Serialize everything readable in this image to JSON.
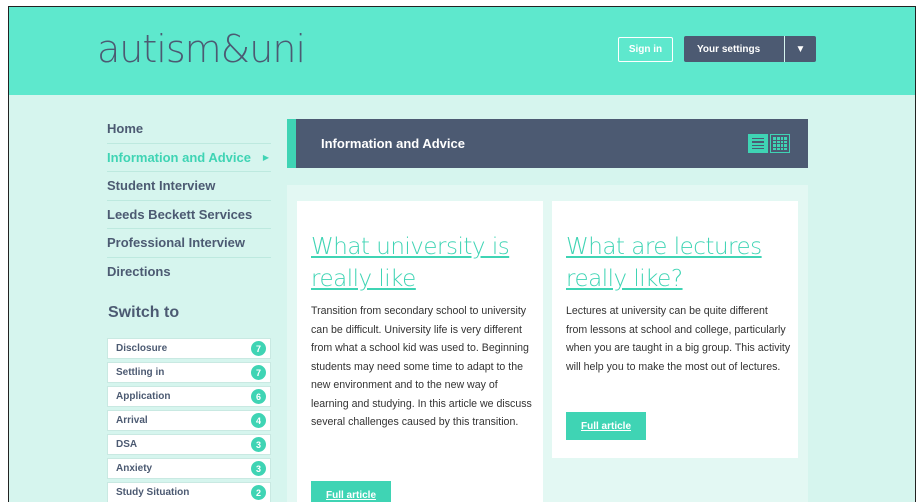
{
  "header": {
    "logo": "autism&uni",
    "signin_label": "Sign in",
    "settings_label": "Your settings",
    "settings_caret": "▼"
  },
  "nav": {
    "items": [
      {
        "label": "Home"
      },
      {
        "label": "Information and Advice",
        "active": true
      },
      {
        "label": "Student Interview"
      },
      {
        "label": "Leeds Beckett Services"
      },
      {
        "label": "Professional Interview"
      },
      {
        "label": "Directions"
      }
    ],
    "active_arrow": "▶"
  },
  "switch": {
    "title": "Switch to",
    "items": [
      {
        "label": "Disclosure",
        "count": "7"
      },
      {
        "label": "Settling in",
        "count": "7"
      },
      {
        "label": "Application",
        "count": "6"
      },
      {
        "label": "Arrival",
        "count": "4"
      },
      {
        "label": "DSA",
        "count": "3"
      },
      {
        "label": "Anxiety",
        "count": "3"
      },
      {
        "label": "Study Situation",
        "count": "2"
      }
    ]
  },
  "section": {
    "title": "Information and Advice",
    "list_view_icon": "list-view-icon",
    "grid_view_icon": "grid-view-icon"
  },
  "articles": [
    {
      "title": "What university is really like",
      "body": "Transition from secondary school to university can be difficult. University life is very different from what a school kid was used to. Beginning students may need some time to adapt to the new environment and to the new way of learning and studying. In this article we discuss several challenges caused by this transition.",
      "button": "Full article"
    },
    {
      "title": "What are lectures really like?",
      "body": "Lectures at university can be quite different from lessons at school and college, particularly when you are taught in a big group. This activity will help you to make the most out of lectures.",
      "button": "Full article"
    }
  ],
  "colors": {
    "header_bg": "#5ee8cd",
    "accent": "#3fd4b4",
    "navy": "#4c5a72",
    "page_bg": "#d6f5ee"
  }
}
